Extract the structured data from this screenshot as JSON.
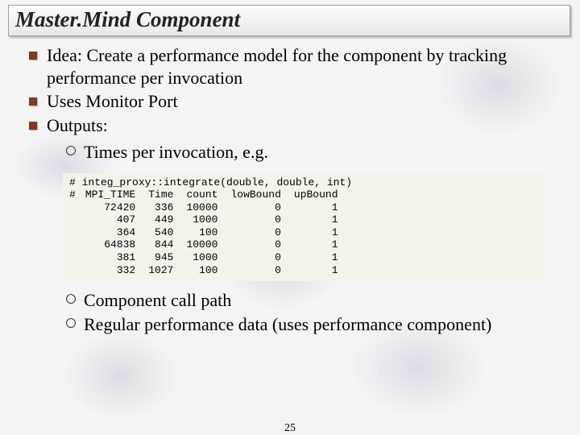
{
  "title": "Master.Mind Component",
  "bullets": {
    "b1": "Idea: Create a performance model for the component by tracking performance per invocation",
    "b2": "Uses Monitor Port",
    "b3": "Outputs:"
  },
  "sub_bullets": {
    "s1": "Times per invocation, e.g.",
    "s2": "Component call path",
    "s3": "Regular performance data (uses performance component)"
  },
  "code": {
    "header_line": "# integ_proxy::integrate(double, double, int)",
    "cols": {
      "hash": "#",
      "c1": "MPI_TIME",
      "c2": "Time",
      "c3": "count",
      "c4": "lowBound",
      "c5": "upBound"
    },
    "rows": [
      {
        "c1": "72420",
        "c2": "336",
        "c3": "10000",
        "c4": "0",
        "c5": "1"
      },
      {
        "c1": "407",
        "c2": "449",
        "c3": "1000",
        "c4": "0",
        "c5": "1"
      },
      {
        "c1": "364",
        "c2": "540",
        "c3": "100",
        "c4": "0",
        "c5": "1"
      },
      {
        "c1": "64838",
        "c2": "844",
        "c3": "10000",
        "c4": "0",
        "c5": "1"
      },
      {
        "c1": "381",
        "c2": "945",
        "c3": "1000",
        "c4": "0",
        "c5": "1"
      },
      {
        "c1": "332",
        "c2": "1027",
        "c3": "100",
        "c4": "0",
        "c5": "1"
      }
    ]
  },
  "pagenum": "25"
}
